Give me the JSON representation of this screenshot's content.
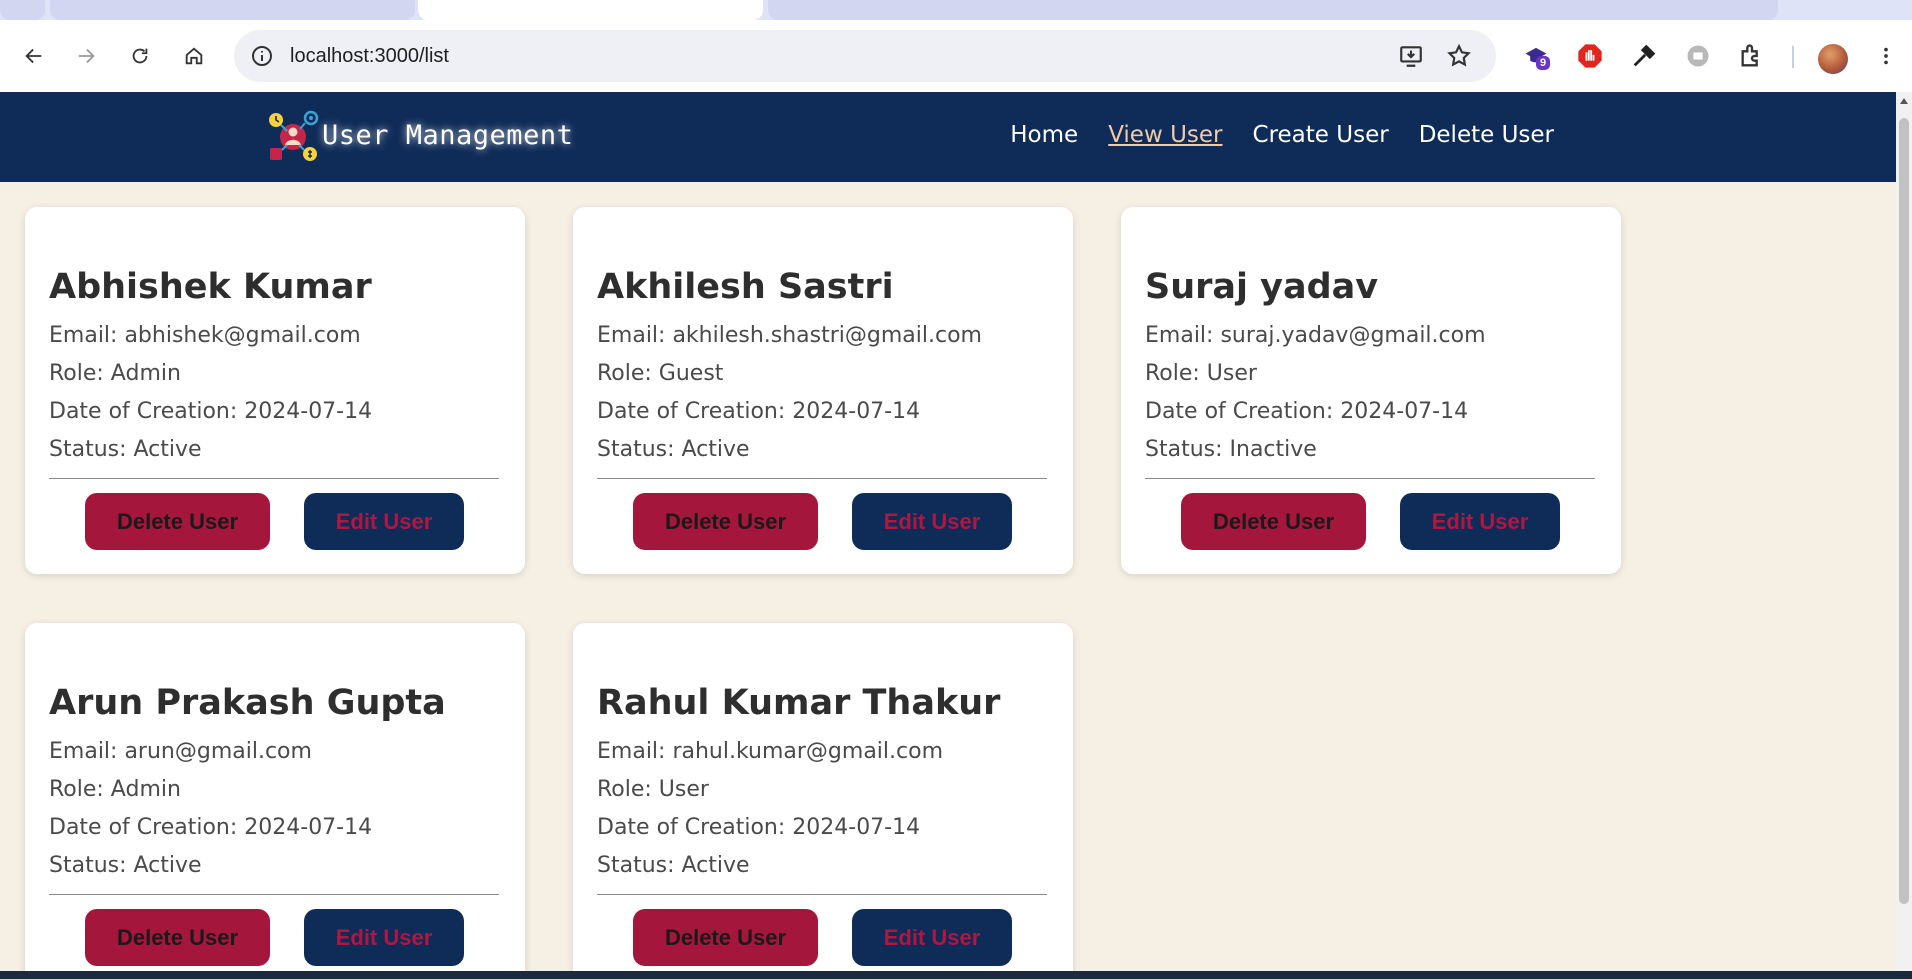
{
  "browser": {
    "url": "localhost:3000/list"
  },
  "extensions": {
    "badge_count": "9"
  },
  "app": {
    "brand": "User Management",
    "nav": [
      {
        "label": "Home",
        "active": false
      },
      {
        "label": "View User",
        "active": true
      },
      {
        "label": "Create User",
        "active": false
      },
      {
        "label": "Delete User",
        "active": false
      }
    ]
  },
  "users": [
    {
      "name": "Abhishek Kumar",
      "email": "Email: abhishek@gmail.com",
      "role": "Role: Admin",
      "created": "Date of Creation: 2024-07-14",
      "status": "Status: Active"
    },
    {
      "name": "Akhilesh Sastri",
      "email": "Email: akhilesh.shastri@gmail.com",
      "role": "Role: Guest",
      "created": "Date of Creation: 2024-07-14",
      "status": "Status: Active"
    },
    {
      "name": "Suraj yadav",
      "email": "Email: suraj.yadav@gmail.com",
      "role": "Role: User",
      "created": "Date of Creation: 2024-07-14",
      "status": "Status: Inactive"
    },
    {
      "name": "Arun Prakash Gupta",
      "email": "Email: arun@gmail.com",
      "role": "Role: Admin",
      "created": "Date of Creation: 2024-07-14",
      "status": "Status: Active"
    },
    {
      "name": "Rahul Kumar Thakur",
      "email": "Email: rahul.kumar@gmail.com",
      "role": "Role: User",
      "created": "Date of Creation: 2024-07-14",
      "status": "Status: Active"
    }
  ],
  "card_actions": {
    "delete_label": "Delete User",
    "edit_label": "Edit User"
  },
  "colors": {
    "navbar": "#0f2c58",
    "page_bg": "#f6efe3",
    "delete_button": "#a5163d",
    "edit_button": "#0f2c58",
    "active_link": "#f0c9a8"
  }
}
